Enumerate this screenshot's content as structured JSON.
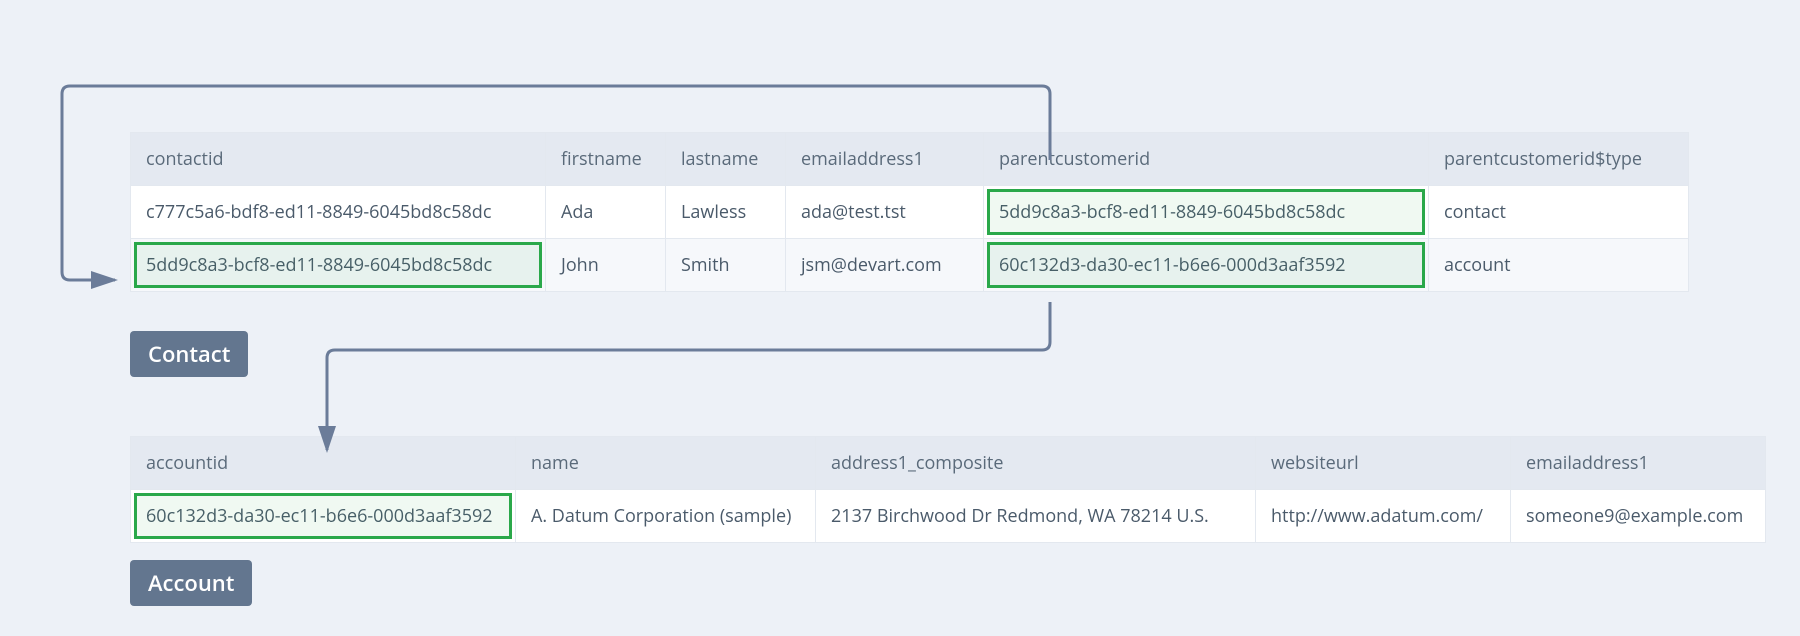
{
  "contact_table": {
    "headers": [
      "contactid",
      "firstname",
      "lastname",
      "emailaddress1",
      "parentcustomerid",
      "parentcustomerid$type"
    ],
    "rows": [
      {
        "cells": [
          {
            "text": "c777c5a6-bdf8-ed11-8849-6045bd8c58dc",
            "highlight": false
          },
          {
            "text": "Ada",
            "highlight": false
          },
          {
            "text": "Lawless",
            "highlight": false
          },
          {
            "text": "ada@test.tst",
            "highlight": false
          },
          {
            "text": "5dd9c8a3-bcf8-ed11-8849-6045bd8c58dc",
            "highlight": true
          },
          {
            "text": "contact",
            "highlight": false
          }
        ]
      },
      {
        "cells": [
          {
            "text": "5dd9c8a3-bcf8-ed11-8849-6045bd8c58dc",
            "highlight": true
          },
          {
            "text": "John",
            "highlight": false
          },
          {
            "text": "Smith",
            "highlight": false
          },
          {
            "text": "jsm@devart.com",
            "highlight": false
          },
          {
            "text": "60c132d3-da30-ec11-b6e6-000d3aaf3592",
            "highlight": true
          },
          {
            "text": "account",
            "highlight": false
          }
        ]
      }
    ]
  },
  "account_table": {
    "headers": [
      "accountid",
      "name",
      "address1_composite",
      "websiteurl",
      "emailaddress1"
    ],
    "rows": [
      {
        "cells": [
          {
            "text": "60c132d3-da30-ec11-b6e6-000d3aaf3592",
            "highlight": true
          },
          {
            "text": "A. Datum Corporation (sample)",
            "highlight": false
          },
          {
            "text": "2137 Birchwood Dr Redmond, WA 78214 U.S.",
            "highlight": false
          },
          {
            "text": "http://www.adatum.com/",
            "highlight": false
          },
          {
            "text": "someone9@example.com",
            "highlight": false
          }
        ]
      }
    ]
  },
  "labels": {
    "contact": "Contact",
    "account": "Account"
  },
  "colors": {
    "arrow": "#6b7c99",
    "highlight_border": "#2aa84a",
    "label_bg": "#63768f"
  }
}
